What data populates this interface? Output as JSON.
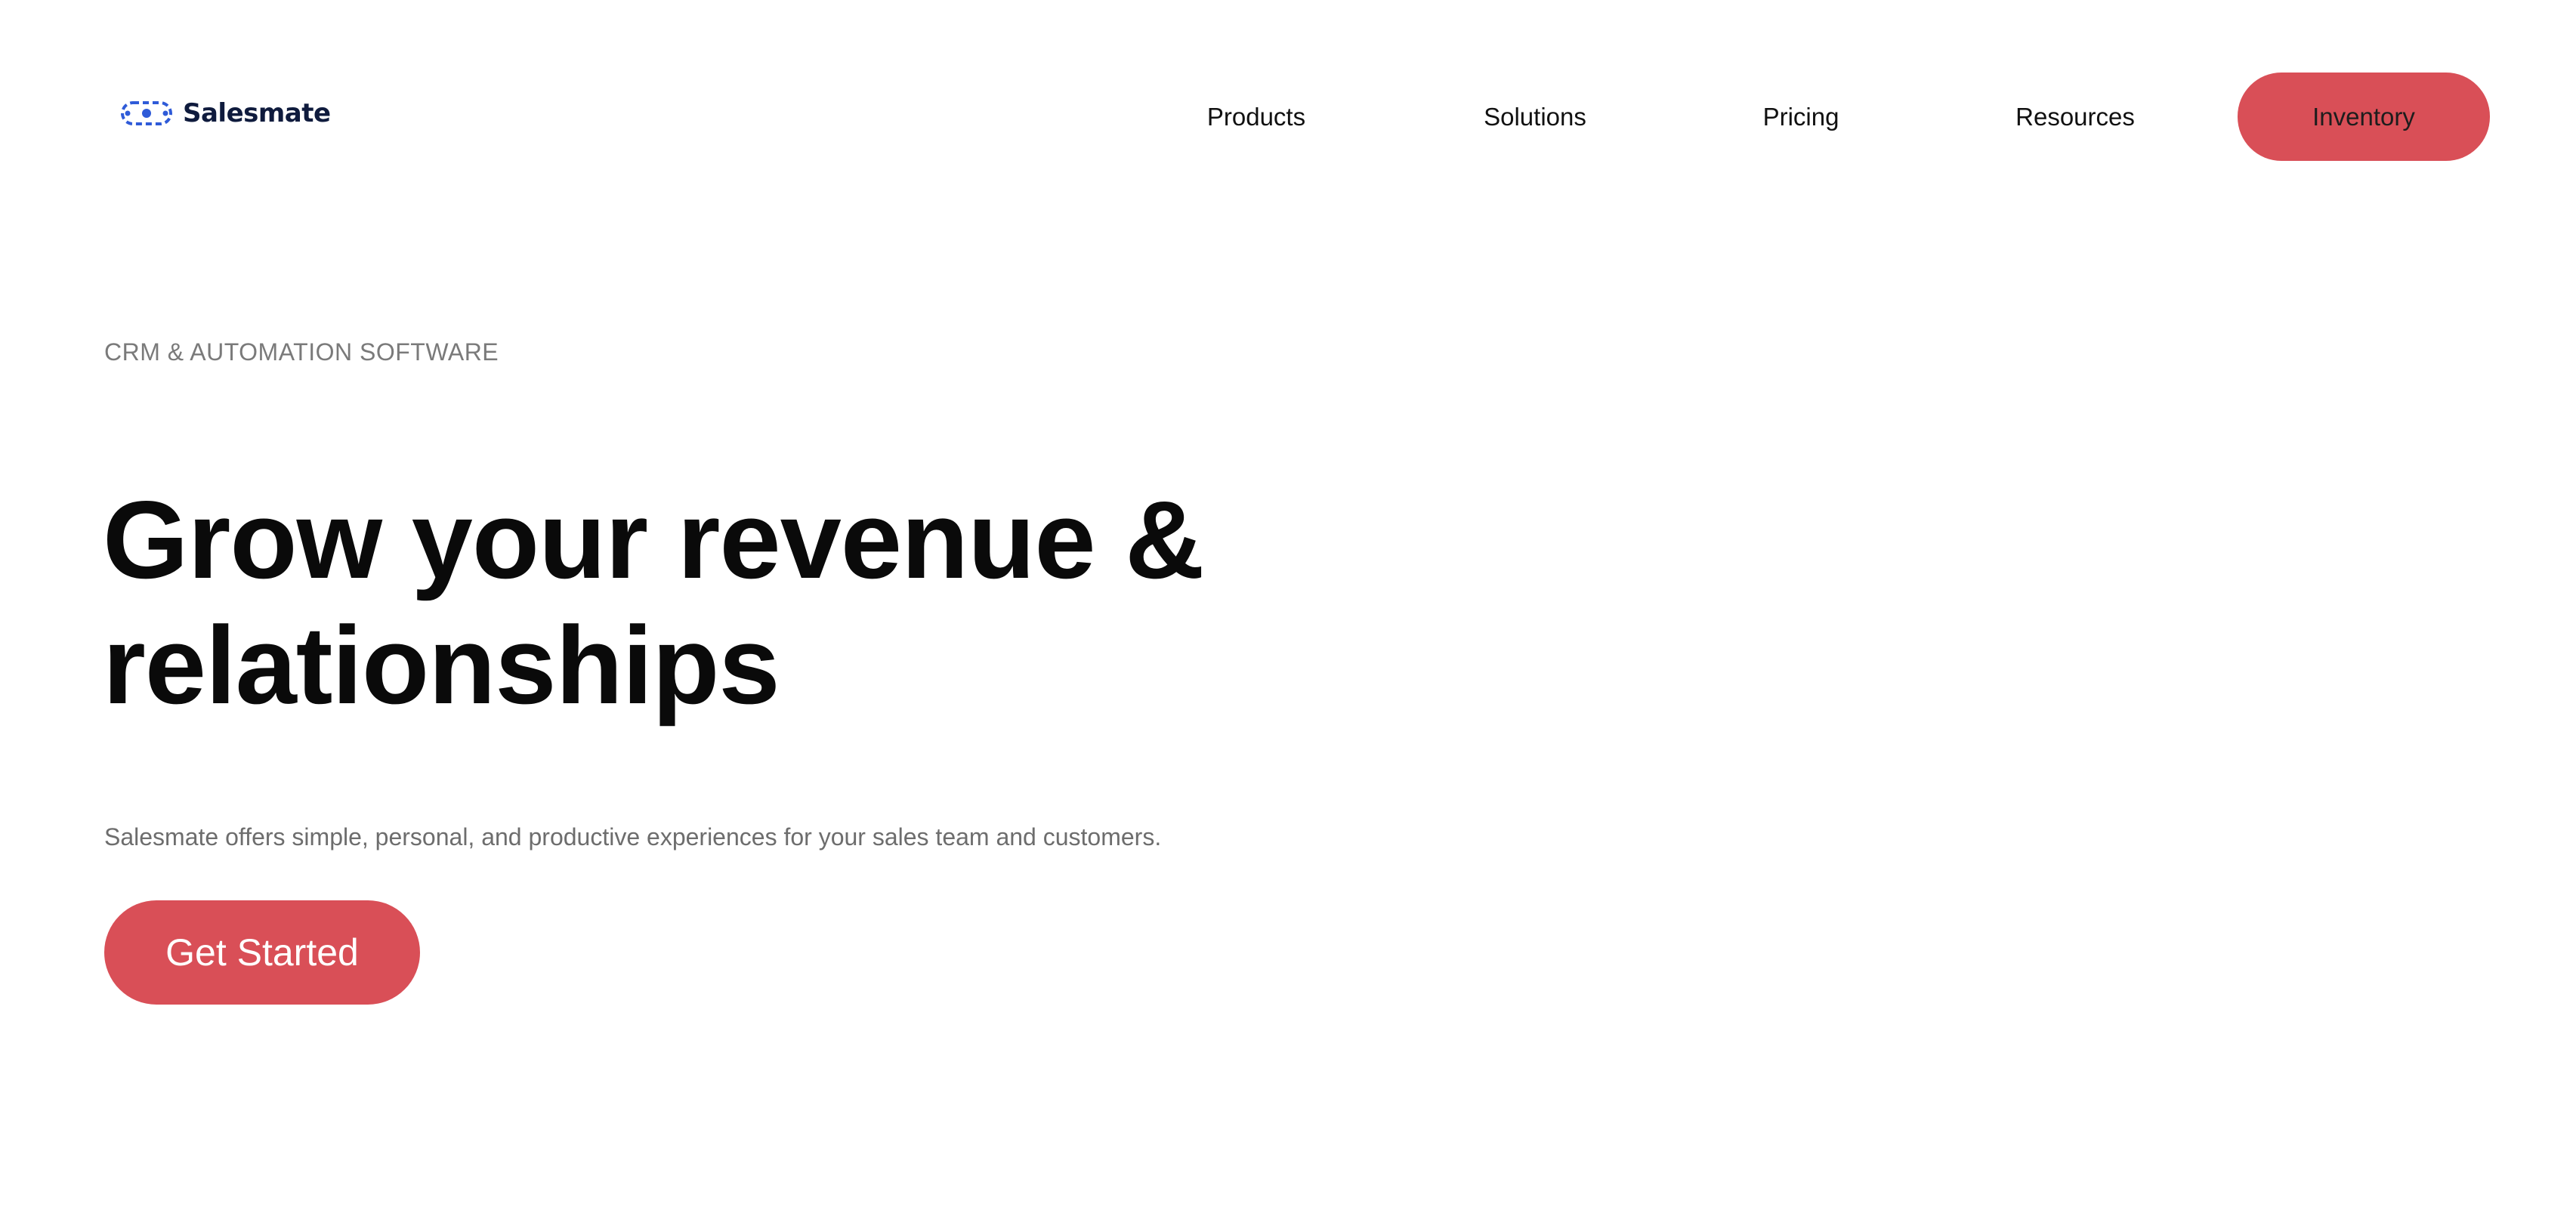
{
  "brand": {
    "name": "Salesmate",
    "icon": "salesmate-logo-icon",
    "color": "#2f5bd8"
  },
  "nav": {
    "items": [
      {
        "label": "Products"
      },
      {
        "label": "Solutions"
      },
      {
        "label": "Pricing"
      },
      {
        "label": "Resources"
      }
    ],
    "cta_label": "Inventory"
  },
  "hero": {
    "eyebrow": "CRM & AUTOMATION SOFTWARE",
    "headline": "Grow your revenue & relationships",
    "subtext": "Salesmate offers simple, personal, and productive experiences for your sales team and customers.",
    "cta_label": "Get Started"
  },
  "colors": {
    "accent": "#d94f57",
    "text": "#0a0a0a",
    "muted": "#7a7a7a"
  }
}
